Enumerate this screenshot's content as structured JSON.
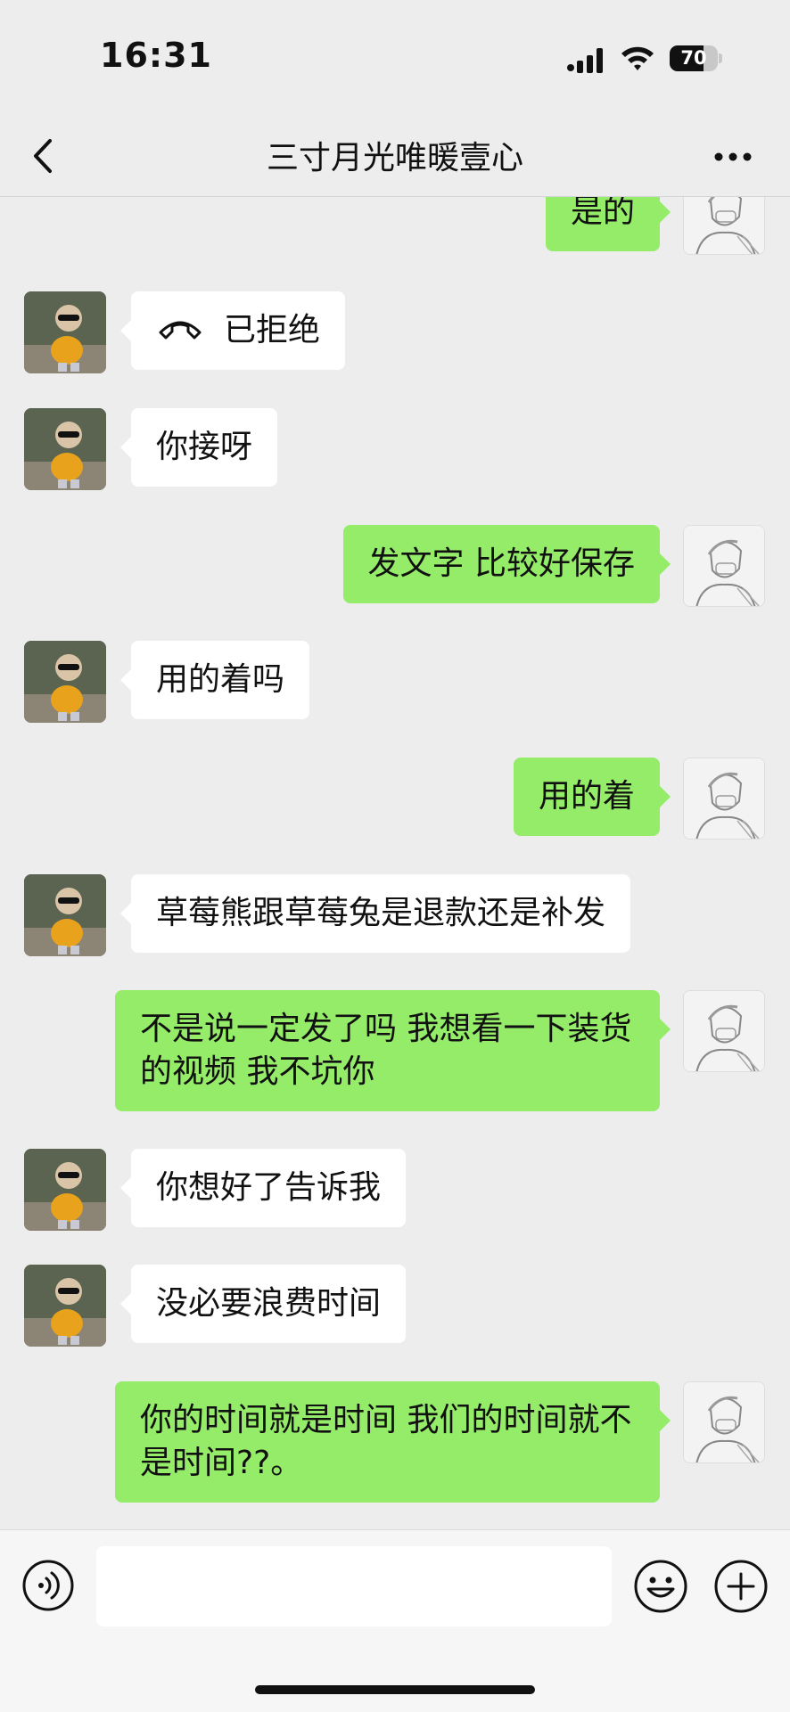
{
  "status_bar": {
    "time": "16:31",
    "battery_level": "70",
    "battery_fraction": 0.7
  },
  "nav": {
    "title": "三寸月光唯暖壹心",
    "back_icon": "chevron-left-icon",
    "more_icon": "ellipsis-icon"
  },
  "messages": [
    {
      "side": "right",
      "text": "是的"
    },
    {
      "side": "left",
      "type": "call",
      "icon": "phone-hangup-icon",
      "text": "已拒绝"
    },
    {
      "side": "left",
      "text": "你接呀"
    },
    {
      "side": "right",
      "text": "发文字 比较好保存"
    },
    {
      "side": "left",
      "text": "用的着吗"
    },
    {
      "side": "right",
      "text": "用的着"
    },
    {
      "side": "left",
      "text": "草莓熊跟草莓兔是退款还是补发"
    },
    {
      "side": "right",
      "text": "不是说一定发了吗 我想看一下装货的视频 我不坑你"
    },
    {
      "side": "left",
      "text": "你想好了告诉我"
    },
    {
      "side": "left",
      "text": "没必要浪费时间"
    },
    {
      "side": "right",
      "text": "你的时间就是时间 我们的时间就不是时间??。"
    }
  ],
  "input_bar": {
    "voice_icon": "voice-icon",
    "input_value": "",
    "emoji_icon": "emoji-icon",
    "plus_icon": "plus-icon"
  },
  "colors": {
    "background": "#ededed",
    "sent_bubble": "#95ec69",
    "received_bubble": "#ffffff"
  }
}
